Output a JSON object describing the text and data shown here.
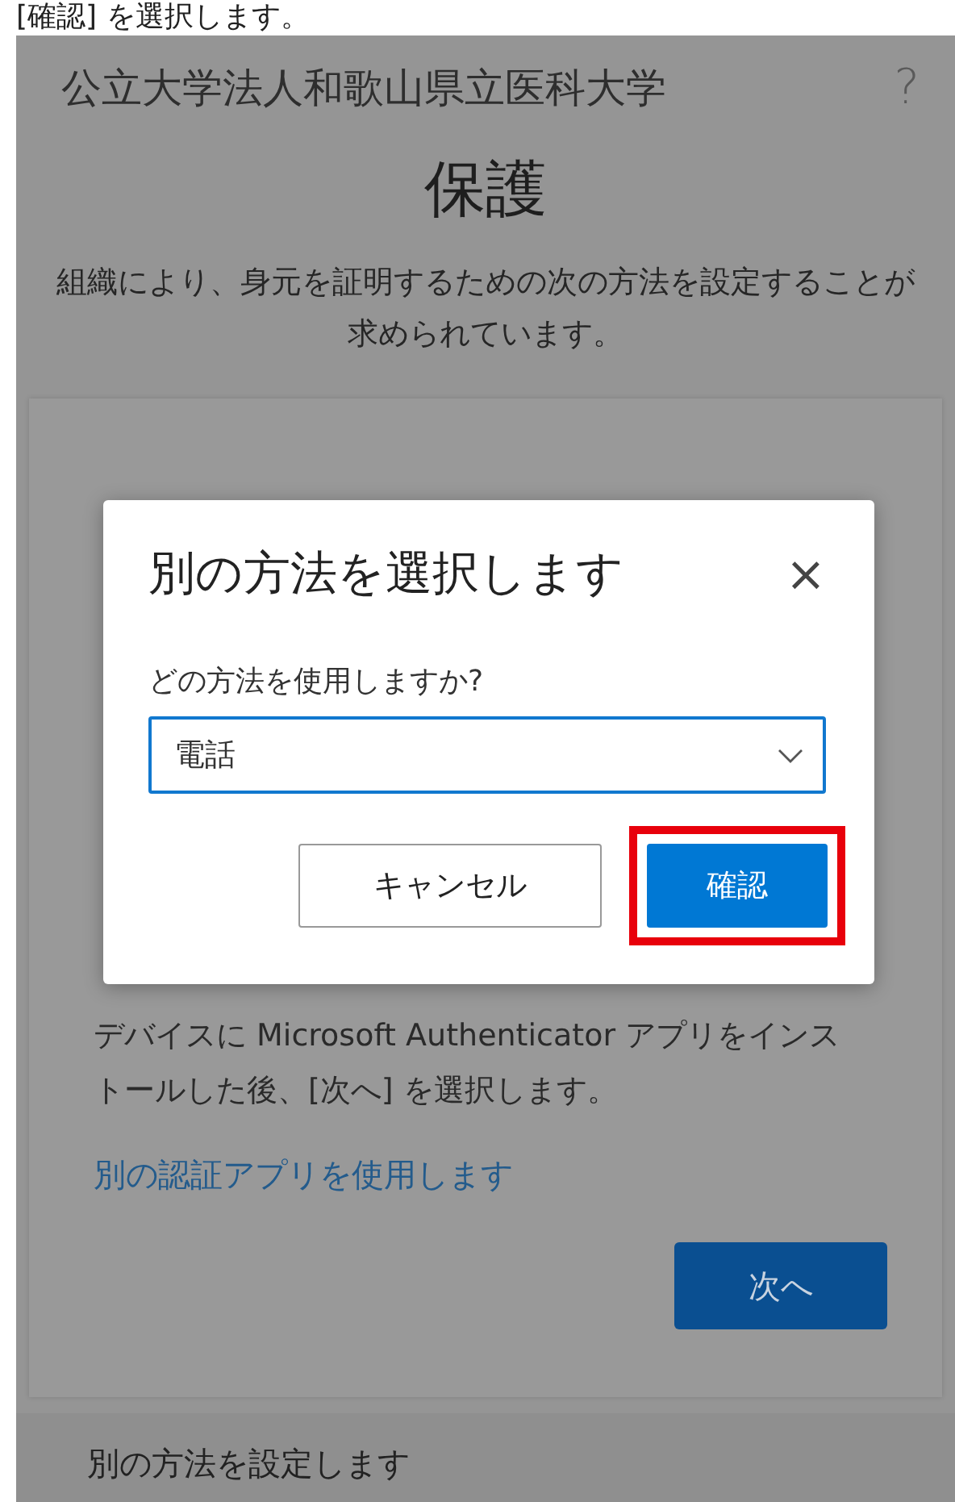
{
  "caption": "[確認] を選択します。",
  "header": {
    "org_name": "公立大学法人和歌山県立医科大学",
    "help": "?"
  },
  "title": "保護",
  "intro": "組織により、身元を証明するための次の方法を設定することが求められています。",
  "card": {
    "instructions": "デバイスに Microsoft Authenticator アプリをインストールした後、[次へ] を選択します。",
    "link": "別の認証アプリを使用します",
    "next_button": "次へ"
  },
  "other_method": "別の方法を設定します",
  "dialog": {
    "title": "別の方法を選択します",
    "close": "×",
    "question": "どの方法を使用しますか?",
    "select_value": "電話",
    "buttons": [
      {
        "label": "キャンセル",
        "kind": "secondary",
        "highlighted": false
      },
      {
        "label": "確認",
        "kind": "primary",
        "highlighted": true
      }
    ]
  }
}
